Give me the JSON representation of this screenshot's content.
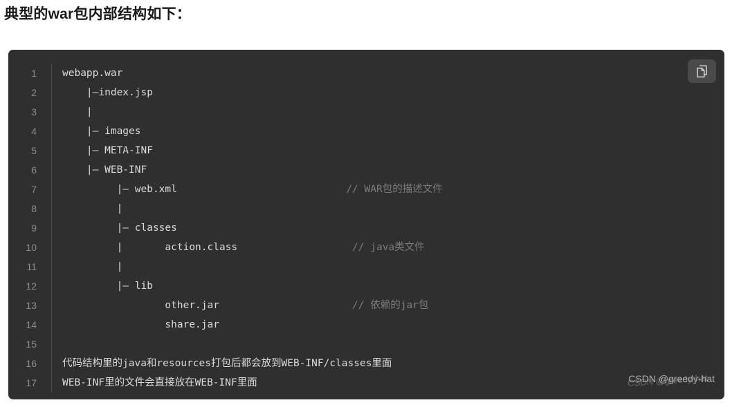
{
  "heading": "典型的war包内部结构如下：",
  "code_block": {
    "language": "plaintext",
    "background_color": "#2f2f2f",
    "text_color": "#d9dadb",
    "comment_color": "#7c7c7c",
    "line_number_color": "#8c8c8c",
    "copy_button": {
      "icon": "copy-icon",
      "label": ""
    },
    "lines": [
      {
        "n": "1",
        "code": "webapp.war",
        "comment": ""
      },
      {
        "n": "2",
        "code": "    |—index.jsp",
        "comment": ""
      },
      {
        "n": "3",
        "code": "    |",
        "comment": ""
      },
      {
        "n": "4",
        "code": "    |— images",
        "comment": ""
      },
      {
        "n": "5",
        "code": "    |— META-INF",
        "comment": ""
      },
      {
        "n": "6",
        "code": "    |— WEB-INF",
        "comment": ""
      },
      {
        "n": "7",
        "code": "         |— web.xml",
        "comment": "// WAR包的描述文件"
      },
      {
        "n": "8",
        "code": "         |",
        "comment": ""
      },
      {
        "n": "9",
        "code": "         |— classes",
        "comment": ""
      },
      {
        "n": "10",
        "code": "         |       action.class",
        "comment": "// java类文件"
      },
      {
        "n": "11",
        "code": "         |",
        "comment": ""
      },
      {
        "n": "12",
        "code": "         |— lib",
        "comment": ""
      },
      {
        "n": "13",
        "code": "                 other.jar",
        "comment": "// 依赖的jar包"
      },
      {
        "n": "14",
        "code": "                 share.jar",
        "comment": ""
      },
      {
        "n": "15",
        "code": "",
        "comment": ""
      },
      {
        "n": "16",
        "code": "代码结构里的java和resources打包后都会放到WEB-INF/classes里面",
        "comment": ""
      },
      {
        "n": "17",
        "code": "WEB-INF里的文件会直接放在WEB-INF里面",
        "comment": ""
      }
    ]
  },
  "watermark": {
    "text": "CSDN @greedy-hat"
  }
}
